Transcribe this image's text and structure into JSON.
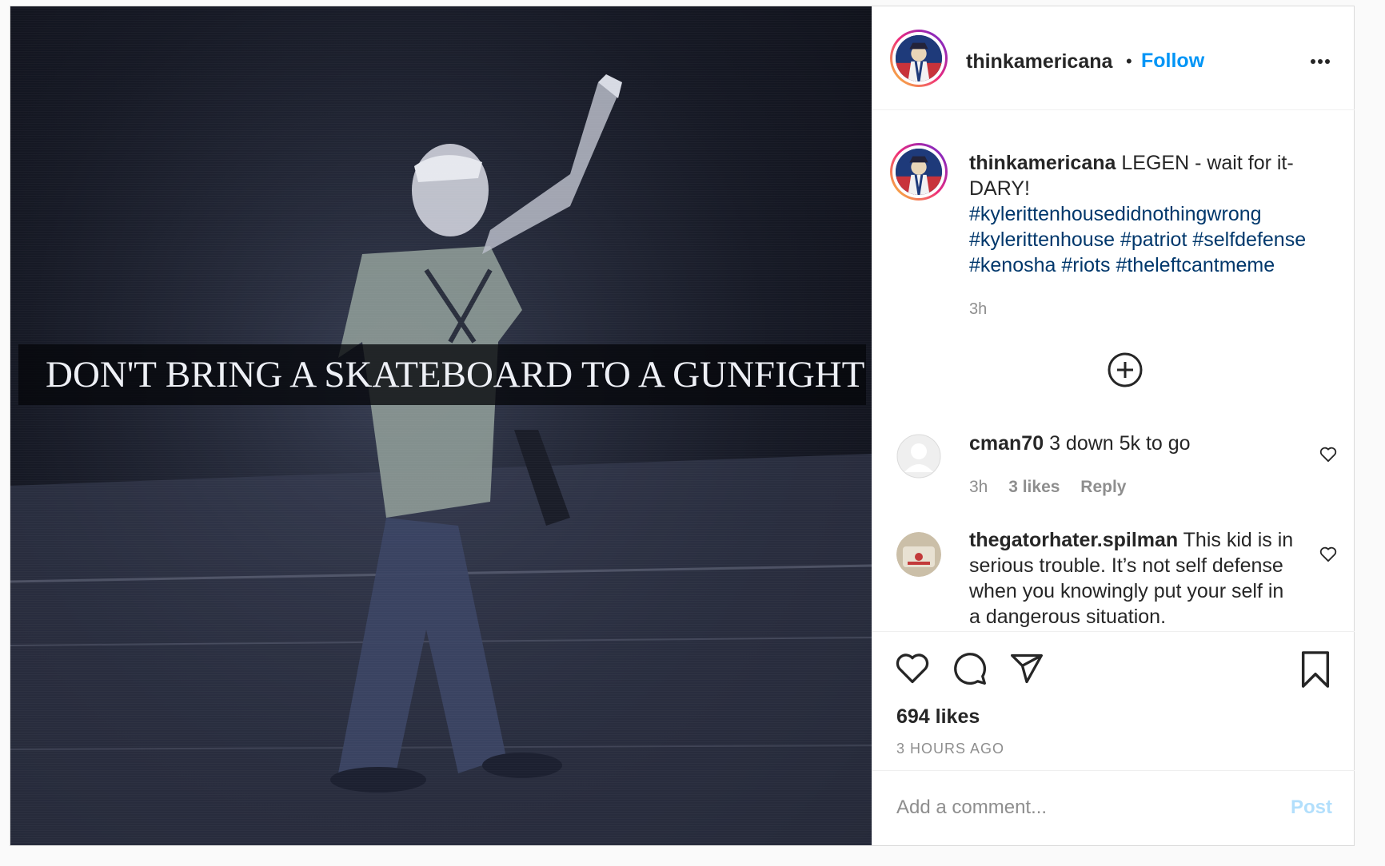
{
  "post": {
    "media": {
      "meme_caption": "DON'T BRING A SKATEBOARD TO A GUNFIGHT"
    },
    "header": {
      "username": "thinkamericana",
      "separator": "•",
      "follow_label": "Follow",
      "more_icon": "more-options-icon"
    },
    "caption": {
      "username": "thinkamericana",
      "text": " LEGEN - wait for it-DARY!",
      "hashtags": "#kylerittenhousedidnothingwrong #kylerittenhouse #patriot #selfdefense #kenosha #riots #theleftcantmeme",
      "time": "3h"
    },
    "load_more_icon": "plus-circle-icon",
    "comments": [
      {
        "username": "cman70",
        "text": " 3 down 5k to go",
        "time": "3h",
        "likes": "3 likes",
        "reply": "Reply"
      },
      {
        "username": "thegatorhater.spilman",
        "text": " This kid is in serious trouble. It’s not self defense when you knowingly put your self in a dangerous situation."
      }
    ],
    "actions": {
      "icons": [
        "heart-icon",
        "comment-icon",
        "share-icon",
        "bookmark-icon"
      ],
      "likes": "694 likes",
      "time_ago": "3 HOURS AGO"
    },
    "comment_bar": {
      "placeholder": "Add a comment...",
      "post_label": "Post"
    },
    "colors": {
      "link_blue": "#0095f6",
      "hashtag": "#00376b",
      "muted": "#8e8e8e",
      "post_disabled": "#b2dffc"
    }
  }
}
